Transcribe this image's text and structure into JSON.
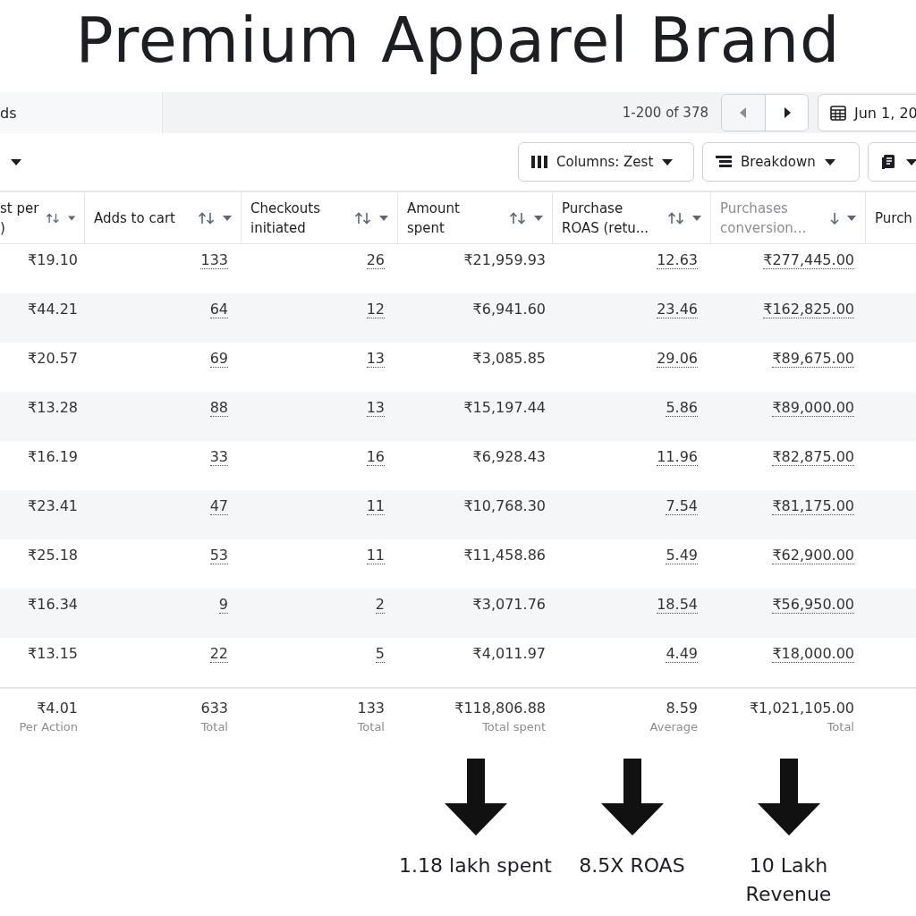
{
  "title": "Premium Apparel Brand",
  "toolbar": {
    "tab": "ds",
    "pagination": "1-200 of 378",
    "date": "Jun 1, 20"
  },
  "actions": [
    {
      "kind": "columns",
      "label": "Columns: Zest"
    },
    {
      "kind": "breakdown",
      "label": "Breakdown"
    },
    {
      "kind": "report"
    }
  ],
  "table": {
    "columns": [
      {
        "label": "st per\n)",
        "sortable": true,
        "dotted": false,
        "sorted": false
      },
      {
        "label": "Adds to cart",
        "sortable": true,
        "dotted": true,
        "sorted": false
      },
      {
        "label": "Checkouts\ninitiated",
        "sortable": true,
        "dotted": true,
        "sorted": false
      },
      {
        "label": "Amount\nspent",
        "sortable": true,
        "dotted": false,
        "sorted": false
      },
      {
        "label": "Purchase\nROAS (retu...",
        "sortable": true,
        "dotted": true,
        "sorted": false
      },
      {
        "label": "Purchases\nconversion...",
        "sortable": true,
        "dotted": true,
        "sorted": true
      },
      {
        "label": "Purch",
        "sorted": false
      }
    ],
    "rows": [
      [
        "₹19.10",
        "133",
        "26",
        "₹21,959.93",
        "12.63",
        "₹277,445.00"
      ],
      [
        "₹44.21",
        "64",
        "12",
        "₹6,941.60",
        "23.46",
        "₹162,825.00"
      ],
      [
        "₹20.57",
        "69",
        "13",
        "₹3,085.85",
        "29.06",
        "₹89,675.00"
      ],
      [
        "₹13.28",
        "88",
        "13",
        "₹15,197.44",
        "5.86",
        "₹89,000.00"
      ],
      [
        "₹16.19",
        "33",
        "16",
        "₹6,928.43",
        "11.96",
        "₹82,875.00"
      ],
      [
        "₹23.41",
        "47",
        "11",
        "₹10,768.30",
        "7.54",
        "₹81,175.00"
      ],
      [
        "₹25.18",
        "53",
        "11",
        "₹11,458.86",
        "5.49",
        "₹62,900.00"
      ],
      [
        "₹16.34",
        "9",
        "2",
        "₹3,071.76",
        "18.54",
        "₹56,950.00"
      ],
      [
        "₹13.15",
        "22",
        "5",
        "₹4,011.97",
        "4.49",
        "₹18,000.00"
      ]
    ],
    "totals": [
      {
        "value": "₹4.01",
        "label": "Per Action"
      },
      {
        "value": "633",
        "label": "Total"
      },
      {
        "value": "133",
        "label": "Total"
      },
      {
        "value": "₹118,806.88",
        "label": "Total spent"
      },
      {
        "value": "8.59",
        "label": "Average"
      },
      {
        "value": "₹1,021,105.00",
        "label": "Total"
      }
    ]
  },
  "annotations": [
    {
      "text": "1.18 lakh spent"
    },
    {
      "text": "8.5X ROAS"
    },
    {
      "text": "10 Lakh\nRevenue"
    }
  ]
}
